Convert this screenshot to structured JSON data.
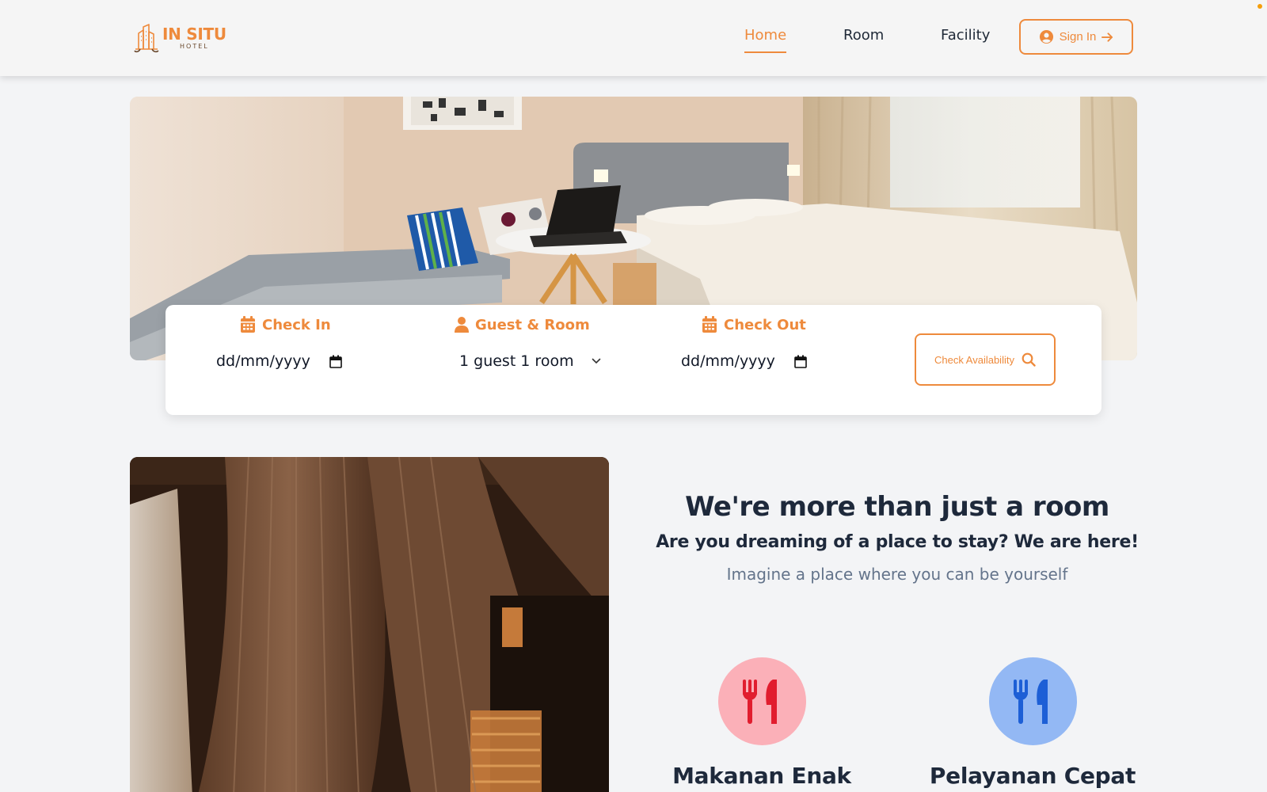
{
  "header": {
    "logo_title": "IN SITU",
    "logo_subtitle": "HOTEL",
    "nav": [
      {
        "label": "Home",
        "active": true
      },
      {
        "label": "Room",
        "active": false
      },
      {
        "label": "Facility",
        "active": false
      }
    ],
    "sign_in_label": "Sign In",
    "sign_in_icons": [
      "user-circle-icon",
      "arrow-right-icon"
    ]
  },
  "hero": {
    "image": "hotel-room-photo"
  },
  "booking": {
    "check_in": {
      "label": "Check In",
      "icon": "calendar-icon",
      "value": "dd/mm/yyyy"
    },
    "guest_room": {
      "label": "Guest & Room",
      "icon": "user-icon",
      "value": "1 guest 1 room"
    },
    "check_out": {
      "label": "Check Out",
      "icon": "calendar-icon",
      "value": "dd/mm/yyyy"
    },
    "check_availability_label": "Check Availability",
    "check_availability_icon": "search-icon"
  },
  "about": {
    "title": "We're more than just a room",
    "subtitle": "Are you dreaming of a place to stay? We are here!",
    "tagline": "Imagine a place where you can be yourself",
    "features": [
      {
        "title": "Makanan Enak",
        "icon": "utensils-icon",
        "color": "#e11d2e"
      },
      {
        "title": "Pelayanan Cepat",
        "icon": "utensils-icon",
        "color": "#1d5fd6"
      }
    ]
  },
  "colors": {
    "accent": "#ee8a3c",
    "background": "#f3f4f6",
    "heading": "#1e293b",
    "muted": "#64748b"
  }
}
